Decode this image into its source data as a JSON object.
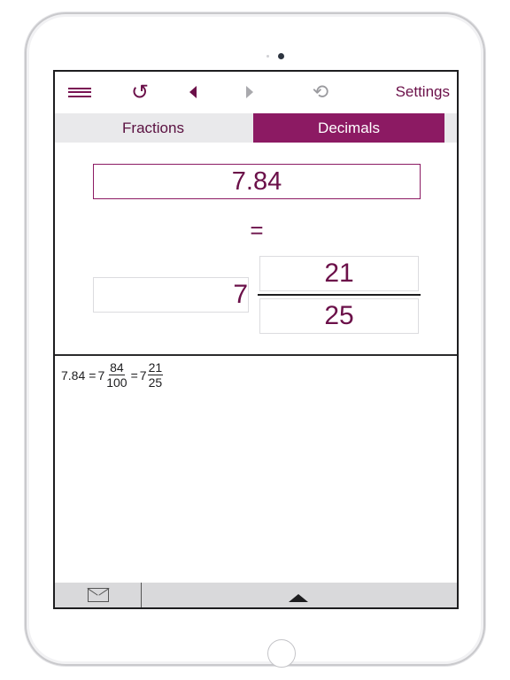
{
  "toolbar": {
    "menu_icon": "hamburger-icon",
    "reload_icon": "reload-icon",
    "reload_glyph": "↺",
    "back_icon": "triangle-left-icon",
    "forward_icon": "triangle-right-icon",
    "undo_icon": "undo-icon",
    "undo_glyph": "⟲",
    "settings_label": "Settings"
  },
  "tabs": [
    {
      "label": "Fractions",
      "active": false
    },
    {
      "label": "Decimals",
      "active": true
    }
  ],
  "converter": {
    "decimal_value": "7.84",
    "equals_sign": "=",
    "whole_part": "7",
    "numerator": "21",
    "denominator": "25"
  },
  "steps": {
    "decimal": "7.84",
    "eq1": "=",
    "whole1": "7",
    "numerator1": "84",
    "denominator1": "100",
    "eq2": "=",
    "whole2": "7",
    "numerator2": "21",
    "denominator2": "25"
  },
  "bottom_bar": {
    "mail_icon": "envelope-icon",
    "expand_icon": "triangle-up-icon"
  },
  "colors": {
    "accent": "#8c1a63",
    "text_accent": "#6b1049",
    "tab_inactive_bg": "#e9e9eb",
    "bottom_bar_bg": "#d9d9db"
  }
}
